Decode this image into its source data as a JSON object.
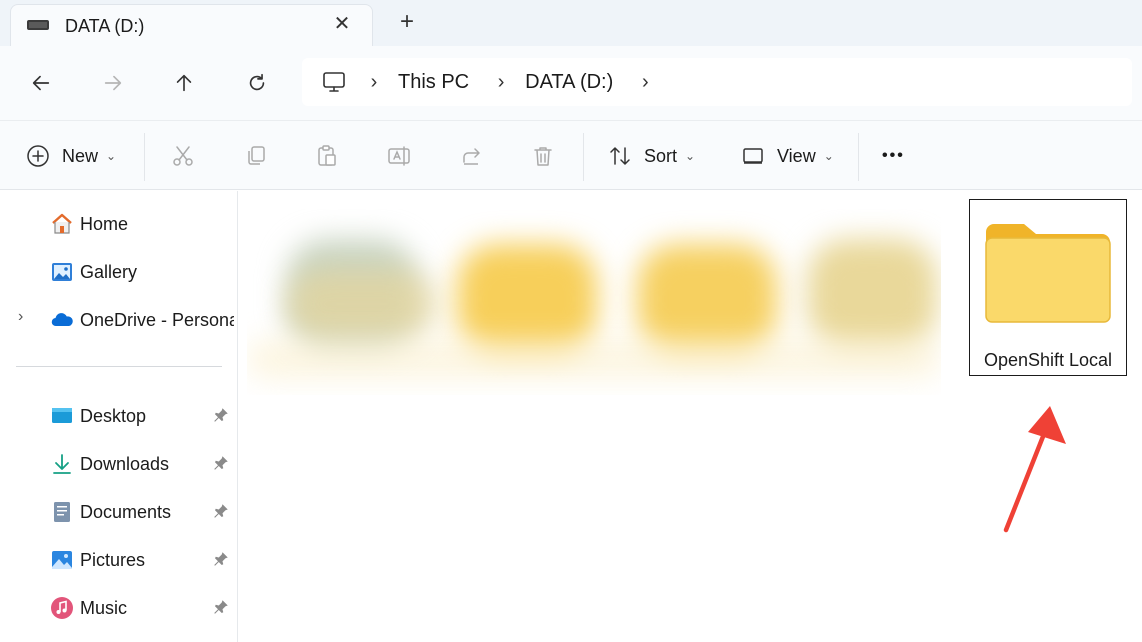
{
  "tab": {
    "title": "DATA (D:)",
    "close": "✕",
    "new_tab": "+"
  },
  "breadcrumb": {
    "items": [
      "This PC",
      "DATA (D:)"
    ]
  },
  "commandbar": {
    "new_label": "New",
    "sort_label": "Sort",
    "view_label": "View",
    "more": "•••"
  },
  "navpane": {
    "top_items": [
      {
        "label": "Home",
        "icon": "home-icon"
      },
      {
        "label": "Gallery",
        "icon": "gallery-icon"
      },
      {
        "label": "OneDrive - Persona",
        "icon": "onedrive-icon"
      }
    ],
    "pinned_items": [
      {
        "label": "Desktop",
        "icon": "desktop-icon"
      },
      {
        "label": "Downloads",
        "icon": "downloads-icon"
      },
      {
        "label": "Documents",
        "icon": "documents-icon"
      },
      {
        "label": "Pictures",
        "icon": "pictures-icon"
      },
      {
        "label": "Music",
        "icon": "music-icon"
      }
    ]
  },
  "content": {
    "highlighted_folder": "OpenShift Local"
  },
  "colors": {
    "folder": "#f7c948",
    "annotation_arrow": "#ef4136",
    "accent": "#0067c0"
  }
}
